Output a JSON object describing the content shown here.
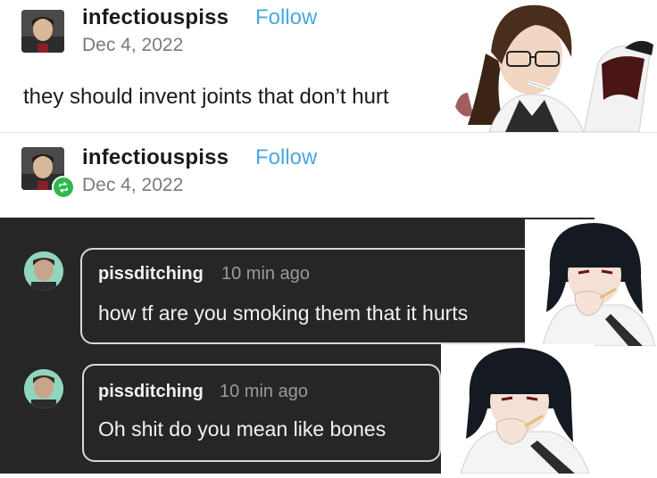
{
  "post": {
    "username": "infectiouspiss",
    "follow_label": "Follow",
    "date": "Dec 4, 2022",
    "text": "they should invent joints that don’t hurt"
  },
  "reblog": {
    "username": "infectiouspiss",
    "follow_label": "Follow",
    "date": "Dec 4, 2022"
  },
  "replies": [
    {
      "username": "pissditching",
      "time": "10 min ago",
      "text": "how tf are you smoking them that it hurts"
    },
    {
      "username": "pissditching",
      "time": "10 min ago",
      "text": "Oh shit do you mean like bones"
    }
  ],
  "colors": {
    "follow": "#4aa8e0",
    "reblog_badge": "#2fb84f",
    "dark_bg": "#262626"
  },
  "icons": [
    "reblog-icon"
  ]
}
